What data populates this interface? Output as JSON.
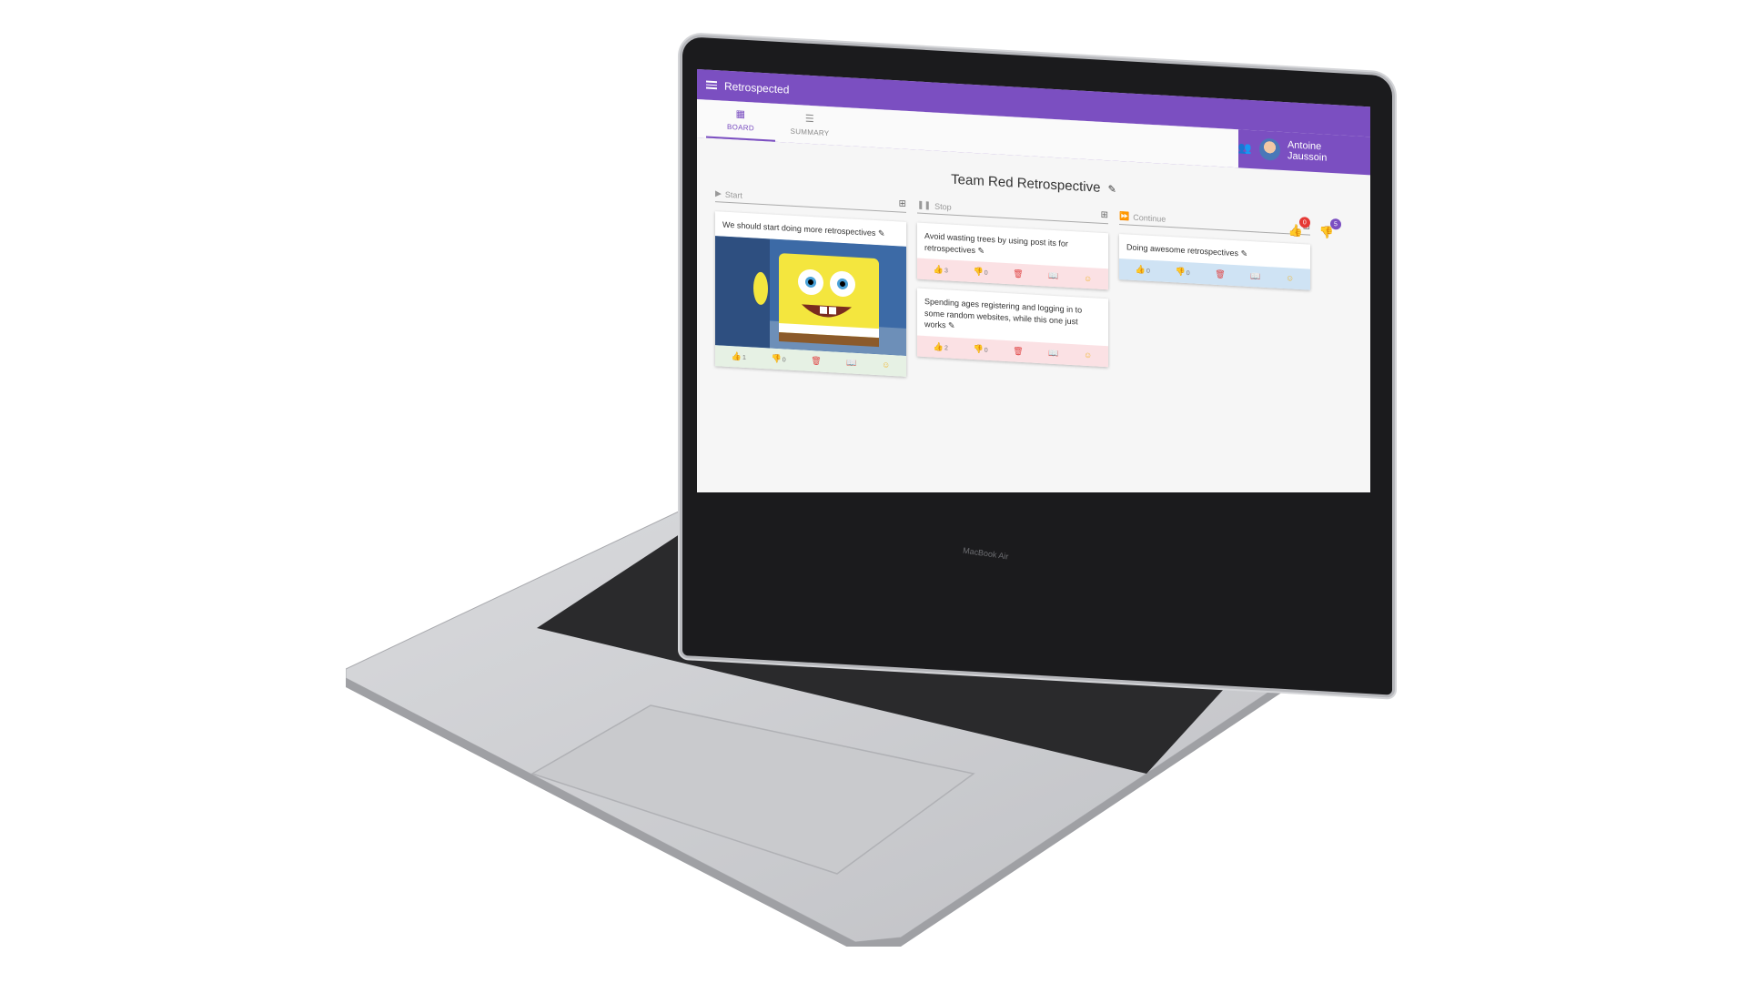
{
  "app": {
    "title": "Retrospected"
  },
  "tabs": [
    {
      "label": "BOARD",
      "icon": "dashboard-icon",
      "active": true
    },
    {
      "label": "SUMMARY",
      "icon": "list-icon",
      "active": false
    }
  ],
  "user": {
    "name": "Antoine Jaussoin",
    "icon": "people-icon"
  },
  "board": {
    "title": "Team Red Retrospective"
  },
  "vote_counters": {
    "up_remaining": "0",
    "down_remaining": "5"
  },
  "columns": [
    {
      "label": "Start",
      "icon": "play-icon",
      "color": "#e6f1e4",
      "cards": [
        {
          "text": "We should start doing more retrospectives",
          "has_gif": true,
          "up": "1",
          "down": "0"
        }
      ]
    },
    {
      "label": "Stop",
      "icon": "pause-icon",
      "color": "#fbe1e4",
      "cards": [
        {
          "text": "Avoid wasting trees by using post its for retrospectives",
          "has_gif": false,
          "up": "3",
          "down": "0"
        },
        {
          "text": "Spending ages registering and logging in to some random websites, while this one just works",
          "has_gif": false,
          "up": "2",
          "down": "0"
        }
      ]
    },
    {
      "label": "Continue",
      "icon": "fast-forward-icon",
      "color": "#cfe3f4",
      "cards": [
        {
          "text": "Doing awesome retrospectives",
          "has_gif": false,
          "up": "0",
          "down": "0"
        }
      ]
    }
  ],
  "device": {
    "keyboard_label": "MacBook Air"
  }
}
